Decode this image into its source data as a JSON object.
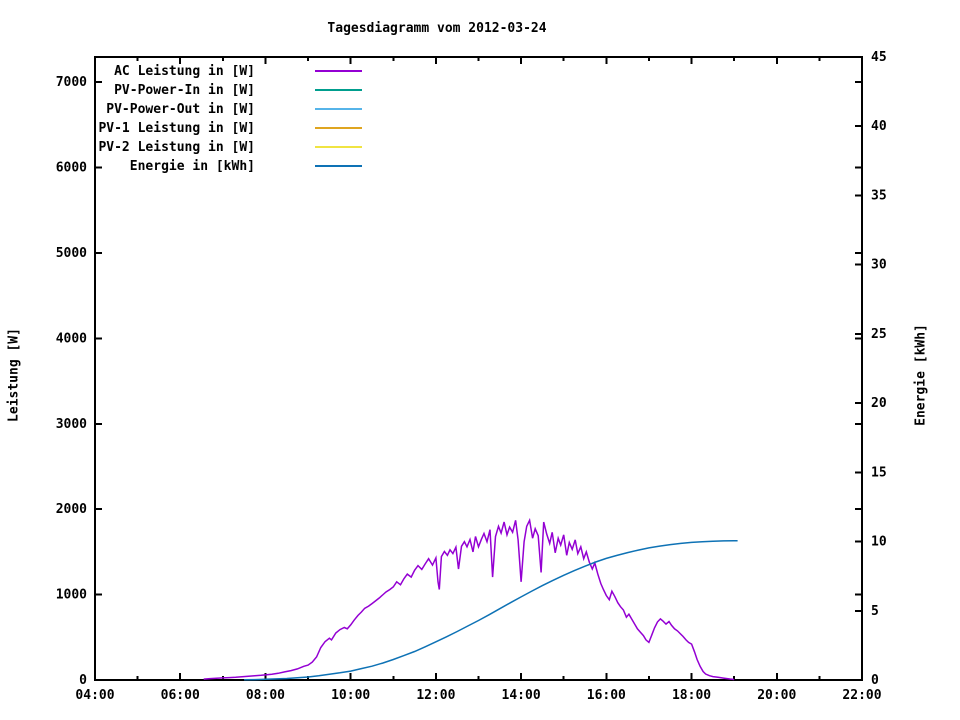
{
  "title": "Tagesdiagramm vom 2012-03-24",
  "axes": {
    "x": {
      "start_hour": 4,
      "end_hour": 22,
      "major_step_hours": 2,
      "minor_step_hours": 1,
      "tick_labels": [
        "04:00",
        "06:00",
        "08:00",
        "10:00",
        "12:00",
        "14:00",
        "16:00",
        "18:00",
        "20:00",
        "22:00"
      ]
    },
    "y_left": {
      "label": "Leistung [W]",
      "tick_values": [
        0,
        1000,
        2000,
        3000,
        4000,
        5000,
        6000,
        7000
      ],
      "tick_labels": [
        "0",
        "1000",
        "2000",
        "3000",
        "4000",
        "5000",
        "6000",
        "7000"
      ],
      "axis_top_value": 7295
    },
    "y_right": {
      "label": "Energie [kWh]",
      "tick_values": [
        0,
        5,
        10,
        15,
        20,
        25,
        30,
        35,
        40,
        45
      ],
      "tick_labels": [
        "0",
        "5",
        "10",
        "15",
        "20",
        "25",
        "30",
        "35",
        "40",
        "45"
      ],
      "min": 0,
      "max": 45
    }
  },
  "chart_data": {
    "type": "line",
    "title": "Tagesdiagramm vom 2012-03-24",
    "xlabel": "",
    "ylabel_left": "Leistung [W]",
    "ylabel_right": "Energie [kWh]",
    "x_range_hours": [
      4,
      22
    ],
    "ylim_left": [
      0,
      7295
    ],
    "ylim_right": [
      0,
      45
    ],
    "grid": false,
    "legend_position": "top-left-inside",
    "series": [
      {
        "name": "AC Leistung in [W]",
        "color": "#9400d3",
        "axis": "left",
        "points": [
          [
            6.55,
            10
          ],
          [
            6.7,
            16
          ],
          [
            6.85,
            20
          ],
          [
            7.0,
            25
          ],
          [
            7.15,
            28
          ],
          [
            7.3,
            32
          ],
          [
            7.45,
            38
          ],
          [
            7.6,
            44
          ],
          [
            7.75,
            50
          ],
          [
            7.9,
            55
          ],
          [
            8.0,
            60
          ],
          [
            8.15,
            68
          ],
          [
            8.3,
            78
          ],
          [
            8.45,
            95
          ],
          [
            8.6,
            110
          ],
          [
            8.75,
            130
          ],
          [
            8.9,
            160
          ],
          [
            9.0,
            175
          ],
          [
            9.1,
            210
          ],
          [
            9.2,
            270
          ],
          [
            9.3,
            380
          ],
          [
            9.4,
            450
          ],
          [
            9.5,
            490
          ],
          [
            9.55,
            470
          ],
          [
            9.65,
            550
          ],
          [
            9.75,
            590
          ],
          [
            9.85,
            615
          ],
          [
            9.92,
            600
          ],
          [
            10.0,
            645
          ],
          [
            10.08,
            700
          ],
          [
            10.17,
            755
          ],
          [
            10.25,
            795
          ],
          [
            10.33,
            840
          ],
          [
            10.42,
            865
          ],
          [
            10.5,
            895
          ],
          [
            10.58,
            925
          ],
          [
            10.67,
            960
          ],
          [
            10.75,
            995
          ],
          [
            10.83,
            1030
          ],
          [
            10.92,
            1060
          ],
          [
            11.0,
            1090
          ],
          [
            11.08,
            1150
          ],
          [
            11.17,
            1115
          ],
          [
            11.25,
            1185
          ],
          [
            11.33,
            1240
          ],
          [
            11.42,
            1205
          ],
          [
            11.5,
            1285
          ],
          [
            11.58,
            1340
          ],
          [
            11.67,
            1295
          ],
          [
            11.75,
            1360
          ],
          [
            11.83,
            1420
          ],
          [
            11.92,
            1345
          ],
          [
            12.0,
            1430
          ],
          [
            12.05,
            1150
          ],
          [
            12.08,
            1060
          ],
          [
            12.13,
            1445
          ],
          [
            12.2,
            1505
          ],
          [
            12.27,
            1460
          ],
          [
            12.33,
            1525
          ],
          [
            12.4,
            1480
          ],
          [
            12.47,
            1555
          ],
          [
            12.53,
            1300
          ],
          [
            12.6,
            1565
          ],
          [
            12.67,
            1620
          ],
          [
            12.73,
            1560
          ],
          [
            12.8,
            1645
          ],
          [
            12.87,
            1500
          ],
          [
            12.93,
            1680
          ],
          [
            13.0,
            1560
          ],
          [
            13.07,
            1650
          ],
          [
            13.13,
            1715
          ],
          [
            13.2,
            1620
          ],
          [
            13.27,
            1760
          ],
          [
            13.33,
            1205
          ],
          [
            13.4,
            1680
          ],
          [
            13.47,
            1800
          ],
          [
            13.53,
            1720
          ],
          [
            13.6,
            1850
          ],
          [
            13.67,
            1700
          ],
          [
            13.73,
            1790
          ],
          [
            13.8,
            1730
          ],
          [
            13.87,
            1870
          ],
          [
            13.93,
            1640
          ],
          [
            14.0,
            1150
          ],
          [
            14.07,
            1620
          ],
          [
            14.13,
            1800
          ],
          [
            14.2,
            1870
          ],
          [
            14.27,
            1660
          ],
          [
            14.33,
            1770
          ],
          [
            14.4,
            1690
          ],
          [
            14.47,
            1260
          ],
          [
            14.53,
            1850
          ],
          [
            14.6,
            1710
          ],
          [
            14.67,
            1600
          ],
          [
            14.73,
            1730
          ],
          [
            14.8,
            1490
          ],
          [
            14.87,
            1660
          ],
          [
            14.93,
            1580
          ],
          [
            15.0,
            1700
          ],
          [
            15.07,
            1460
          ],
          [
            15.13,
            1610
          ],
          [
            15.2,
            1530
          ],
          [
            15.27,
            1640
          ],
          [
            15.33,
            1480
          ],
          [
            15.4,
            1560
          ],
          [
            15.47,
            1420
          ],
          [
            15.53,
            1500
          ],
          [
            15.6,
            1380
          ],
          [
            15.67,
            1300
          ],
          [
            15.73,
            1370
          ],
          [
            15.8,
            1240
          ],
          [
            15.87,
            1130
          ],
          [
            15.93,
            1060
          ],
          [
            16.0,
            990
          ],
          [
            16.07,
            940
          ],
          [
            16.13,
            1040
          ],
          [
            16.2,
            975
          ],
          [
            16.27,
            905
          ],
          [
            16.33,
            860
          ],
          [
            16.4,
            820
          ],
          [
            16.47,
            735
          ],
          [
            16.53,
            770
          ],
          [
            16.6,
            710
          ],
          [
            16.67,
            650
          ],
          [
            16.73,
            600
          ],
          [
            16.8,
            560
          ],
          [
            16.87,
            520
          ],
          [
            16.93,
            470
          ],
          [
            17.0,
            440
          ],
          [
            17.07,
            530
          ],
          [
            17.13,
            610
          ],
          [
            17.2,
            680
          ],
          [
            17.27,
            715
          ],
          [
            17.33,
            690
          ],
          [
            17.4,
            655
          ],
          [
            17.47,
            685
          ],
          [
            17.53,
            640
          ],
          [
            17.6,
            600
          ],
          [
            17.67,
            575
          ],
          [
            17.73,
            545
          ],
          [
            17.8,
            510
          ],
          [
            17.87,
            470
          ],
          [
            17.93,
            440
          ],
          [
            18.0,
            420
          ],
          [
            18.07,
            330
          ],
          [
            18.13,
            240
          ],
          [
            18.2,
            160
          ],
          [
            18.27,
            100
          ],
          [
            18.33,
            70
          ],
          [
            18.42,
            50
          ],
          [
            18.5,
            40
          ],
          [
            18.62,
            32
          ],
          [
            18.75,
            22
          ],
          [
            18.9,
            12
          ],
          [
            19.0,
            6
          ]
        ]
      },
      {
        "name": "PV-Power-In in [W]",
        "color": "#009e8e",
        "axis": "left",
        "points": []
      },
      {
        "name": "PV-Power-Out in [W]",
        "color": "#56b4e9",
        "axis": "left",
        "points": []
      },
      {
        "name": "PV-1 Leistung in [W]",
        "color": "#dfa520",
        "axis": "left",
        "points": []
      },
      {
        "name": "PV-2 Leistung in [W]",
        "color": "#f0e442",
        "axis": "left",
        "points": []
      },
      {
        "name": "Energie in [kWh]",
        "color": "#0e72b5",
        "axis": "right",
        "points": [
          [
            7.5,
            0.02
          ],
          [
            7.75,
            0.03
          ],
          [
            8.0,
            0.05
          ],
          [
            8.25,
            0.08
          ],
          [
            8.5,
            0.11
          ],
          [
            8.75,
            0.16
          ],
          [
            9.0,
            0.22
          ],
          [
            9.25,
            0.3
          ],
          [
            9.5,
            0.42
          ],
          [
            9.75,
            0.52
          ],
          [
            10.0,
            0.64
          ],
          [
            10.25,
            0.82
          ],
          [
            10.5,
            1.0
          ],
          [
            10.75,
            1.22
          ],
          [
            11.0,
            1.48
          ],
          [
            11.25,
            1.76
          ],
          [
            11.5,
            2.06
          ],
          [
            11.75,
            2.4
          ],
          [
            12.0,
            2.76
          ],
          [
            12.25,
            3.12
          ],
          [
            12.5,
            3.5
          ],
          [
            12.75,
            3.9
          ],
          [
            13.0,
            4.3
          ],
          [
            13.25,
            4.72
          ],
          [
            13.5,
            5.15
          ],
          [
            13.75,
            5.58
          ],
          [
            14.0,
            6.0
          ],
          [
            14.25,
            6.42
          ],
          [
            14.5,
            6.82
          ],
          [
            14.75,
            7.2
          ],
          [
            15.0,
            7.56
          ],
          [
            15.25,
            7.9
          ],
          [
            15.5,
            8.22
          ],
          [
            15.75,
            8.52
          ],
          [
            16.0,
            8.78
          ],
          [
            16.25,
            9.0
          ],
          [
            16.5,
            9.2
          ],
          [
            16.75,
            9.38
          ],
          [
            17.0,
            9.54
          ],
          [
            17.25,
            9.67
          ],
          [
            17.5,
            9.78
          ],
          [
            17.75,
            9.87
          ],
          [
            18.0,
            9.94
          ],
          [
            18.25,
            9.99
          ],
          [
            18.5,
            10.02
          ],
          [
            18.75,
            10.05
          ],
          [
            19.0,
            10.06
          ],
          [
            19.08,
            10.06
          ]
        ]
      }
    ]
  },
  "colors": {
    "foreground": "#000000",
    "background": "#ffffff"
  }
}
